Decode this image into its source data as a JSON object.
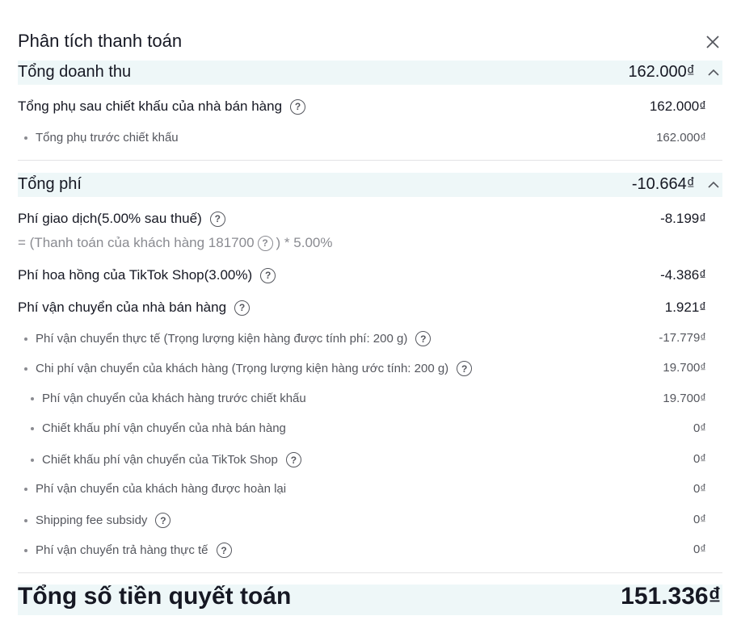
{
  "header": {
    "title": "Phân tích thanh toán"
  },
  "revenue": {
    "label": "Tổng doanh thu",
    "amount": "162.000₫",
    "rows": [
      {
        "label": "Tổng phụ sau chiết khấu của nhà bán hàng",
        "amount": "162.000₫"
      },
      {
        "label": "Tổng phụ trước chiết khấu",
        "amount": "162.000₫"
      }
    ]
  },
  "fees": {
    "label": "Tổng phí",
    "amount": "-10.664₫",
    "transaction": {
      "label": "Phí giao dịch(5.00% sau thuế)",
      "amount": "-8.199₫",
      "formula_prefix": "= (Thanh toán của khách hàng 181700",
      "formula_suffix": ") * 5.00%"
    },
    "commission": {
      "label": "Phí hoa hồng của TikTok Shop(3.00%)",
      "amount": "-4.386₫"
    },
    "shipping": {
      "label": "Phí vận chuyển của nhà bán hàng",
      "amount": "1.921₫",
      "items": [
        {
          "label": "Phí vận chuyển thực tế (Trọng lượng kiện hàng được tính phí: 200 g)",
          "amount": "-17.779₫"
        },
        {
          "label": "Chi phí vận chuyển của khách hàng (Trọng lượng kiện hàng ước tính: 200 g)",
          "amount": "19.700₫"
        },
        {
          "label": "Phí vận chuyển của khách hàng trước chiết khấu",
          "amount": "19.700₫"
        },
        {
          "label": "Chiết khấu phí vận chuyển của nhà bán hàng",
          "amount": "0₫"
        },
        {
          "label": "Chiết khấu phí vận chuyển của TikTok Shop",
          "amount": "0₫"
        },
        {
          "label": "Phí vận chuyển của khách hàng được hoàn lại",
          "amount": "0₫"
        },
        {
          "label": "Shipping fee subsidy",
          "amount": "0₫"
        },
        {
          "label": "Phí vận chuyển trả hàng thực tế",
          "amount": "0₫"
        }
      ]
    }
  },
  "total": {
    "label": "Tổng số tiền quyết toán",
    "amount": "151.336₫"
  },
  "icons": {
    "close": "close-icon",
    "collapse": "chevron-up-icon",
    "help": "question-circle-icon"
  },
  "colors": {
    "band": "#eef7f8",
    "text": "#161823",
    "muted": "#55575e"
  }
}
